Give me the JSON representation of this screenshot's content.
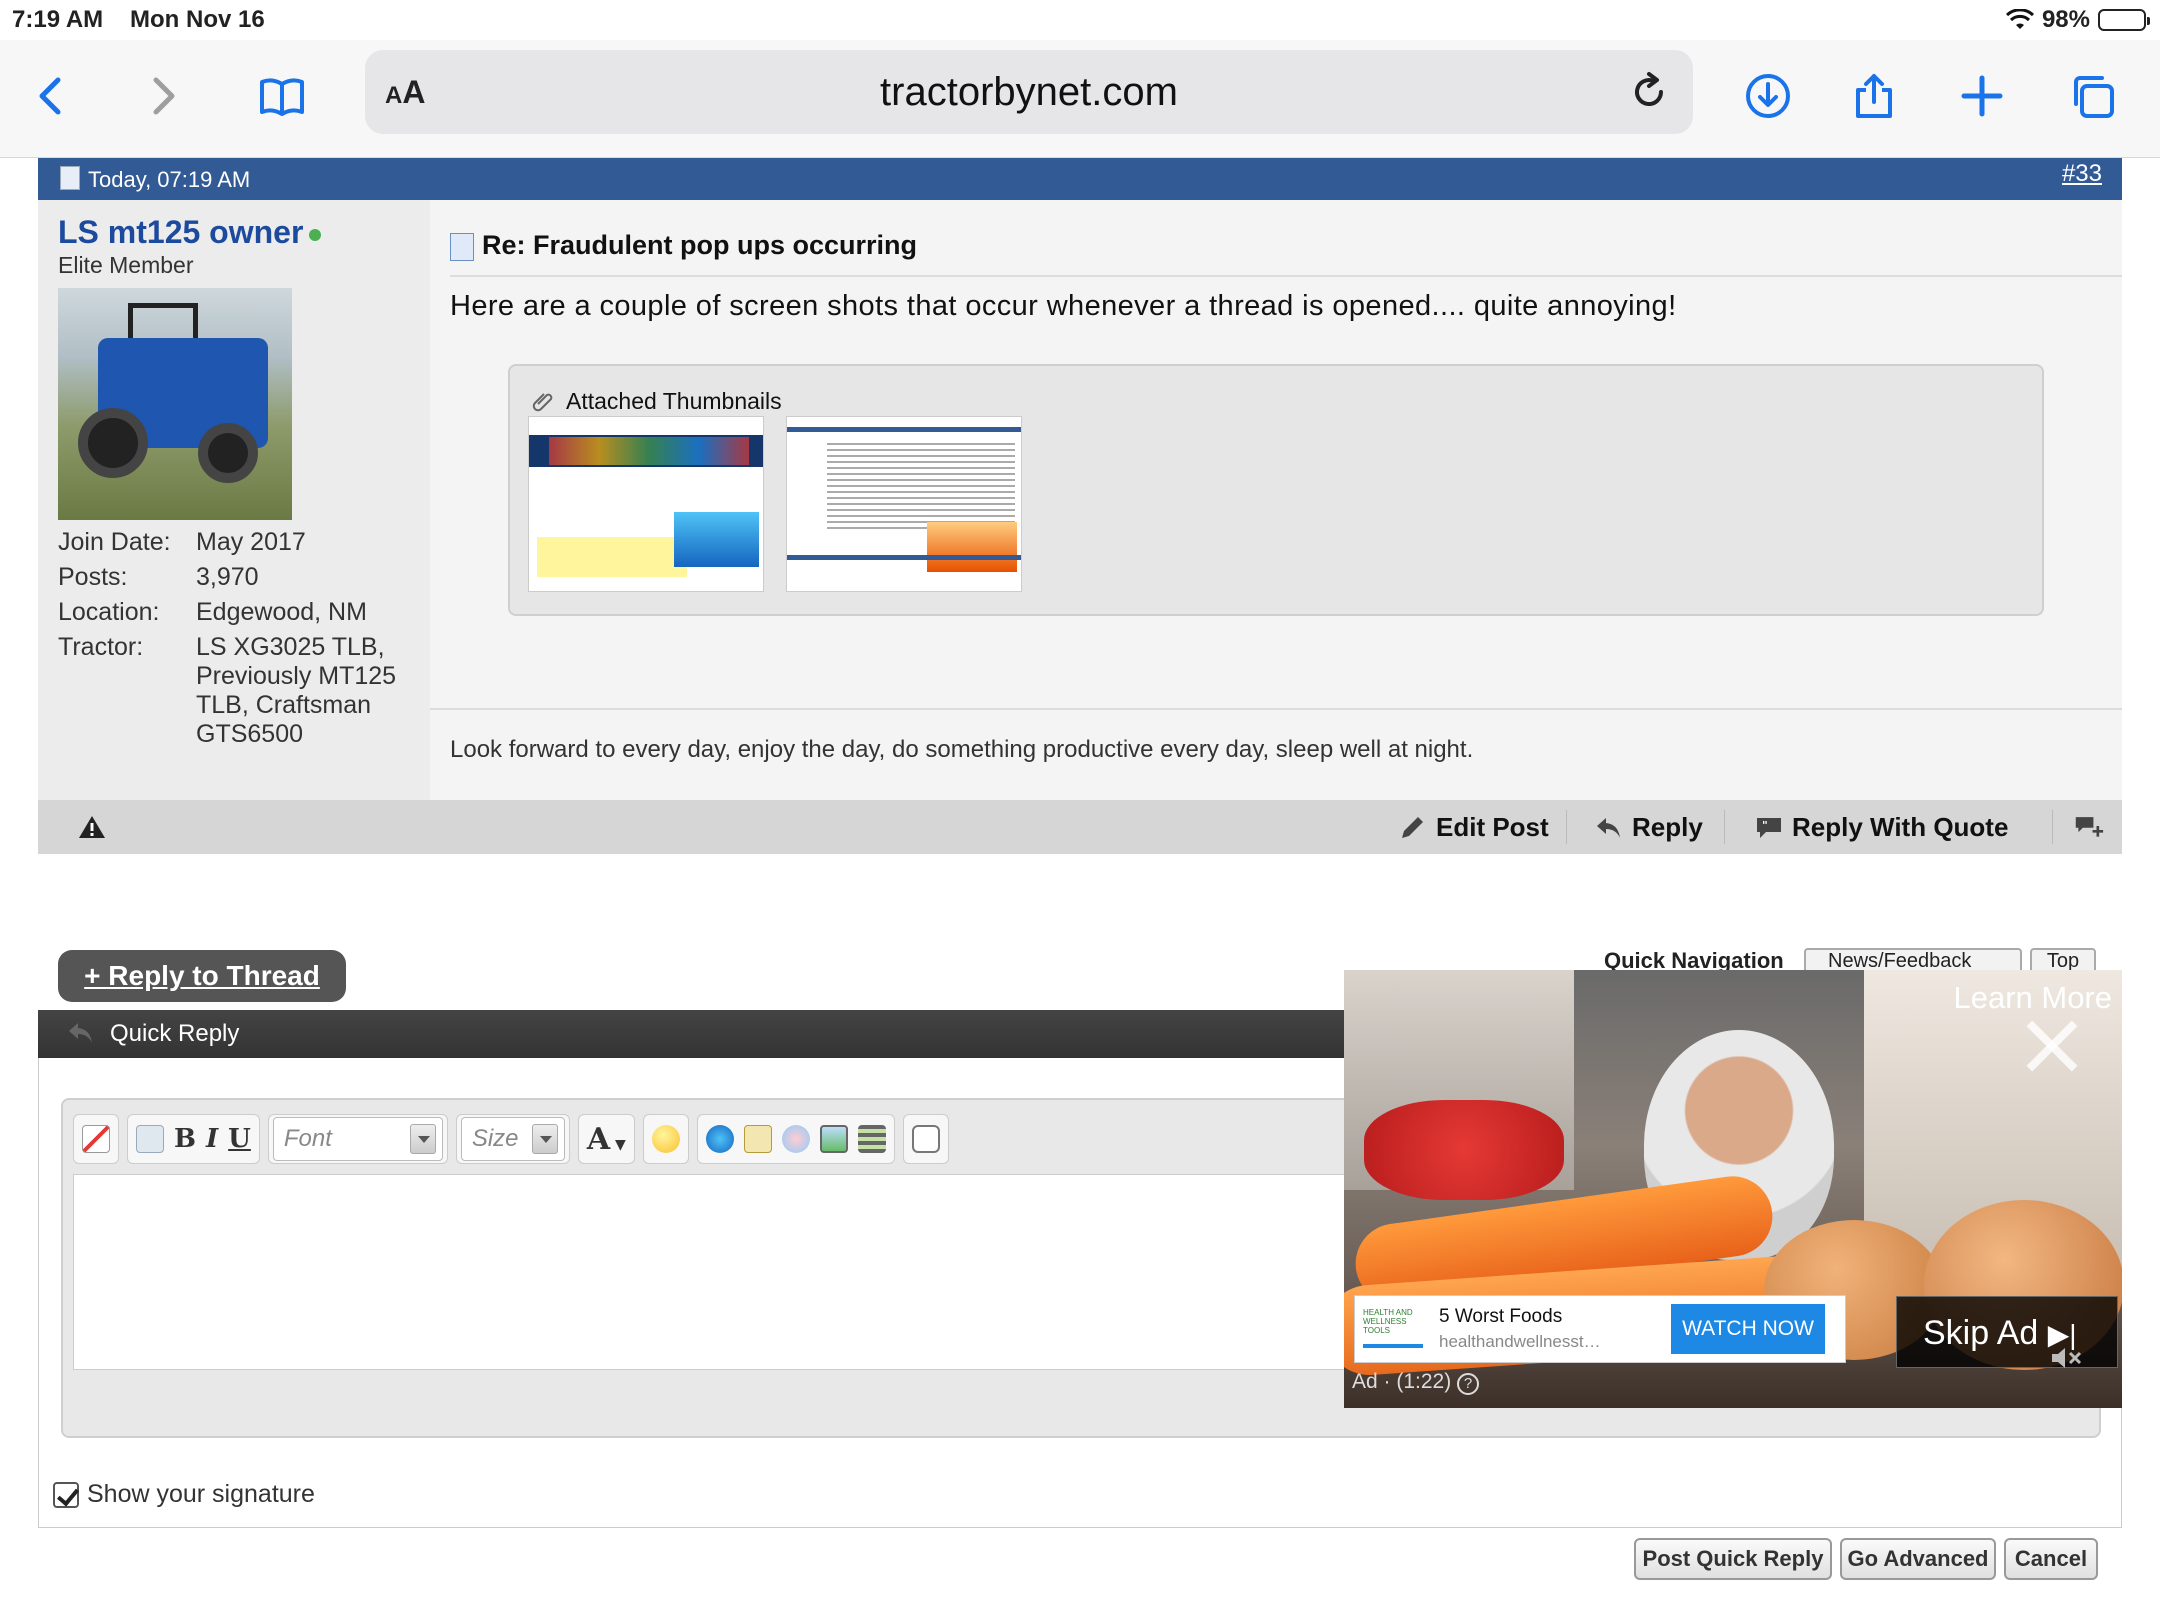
{
  "status": {
    "time": "7:19 AM",
    "date": "Mon Nov 16",
    "battery": "98%"
  },
  "browser": {
    "url": "tractorbynet.com",
    "text_size_label_small": "A",
    "text_size_label_large": "A"
  },
  "post": {
    "timestamp": "Today, 07:19 AM",
    "number": "#33",
    "title": "Re: Fraudulent pop ups occurring",
    "body": "Here are a couple of screen shots that occur whenever a thread is opened.... quite annoying!",
    "attachments_label": "Attached Thumbnails",
    "signature": "Look forward to every day, enjoy the day, do something productive every day, sleep well at night."
  },
  "user": {
    "name": "LS mt125 owner",
    "title": "Elite Member",
    "info": [
      {
        "label": "Join Date:",
        "value": "May 2017"
      },
      {
        "label": "Posts:",
        "value": "3,970"
      },
      {
        "label": "Location:",
        "value": "Edgewood, NM"
      },
      {
        "label": "Tractor:",
        "value": "LS XG3025 TLB, Previously MT125 TLB, Craftsman GTS6500"
      }
    ]
  },
  "post_actions": {
    "edit": "Edit Post",
    "reply": "Reply",
    "reply_quote": "Reply With Quote"
  },
  "thread": {
    "reply_button": "+ Reply to Thread",
    "quick_nav_label": "Quick Navigation",
    "quick_nav_value": "News/Feedback",
    "top_label": "Top"
  },
  "quick_reply": {
    "title": "Quick Reply",
    "font_placeholder": "Font",
    "size_placeholder": "Size",
    "bold": "B",
    "italic": "I",
    "underline": "U",
    "text_color": "A",
    "show_signature": "Show your signature",
    "post_button": "Post Quick Reply",
    "advanced_button": "Go Advanced",
    "cancel_button": "Cancel"
  },
  "ad": {
    "learn_more": "Learn More",
    "headline": "5 Worst Foods",
    "domain": "healthandwellnesstools.c...",
    "cta": "WATCH NOW",
    "skip": "Skip Ad",
    "tag": "Ad · (1:22)",
    "logo_text": "HEALTH AND WELLNESS TOOLS"
  },
  "colors": {
    "post_header": "#325a94",
    "username": "#1c4a9c",
    "browser_accent": "#1a73e8",
    "ad_cta": "#1e88e5"
  }
}
